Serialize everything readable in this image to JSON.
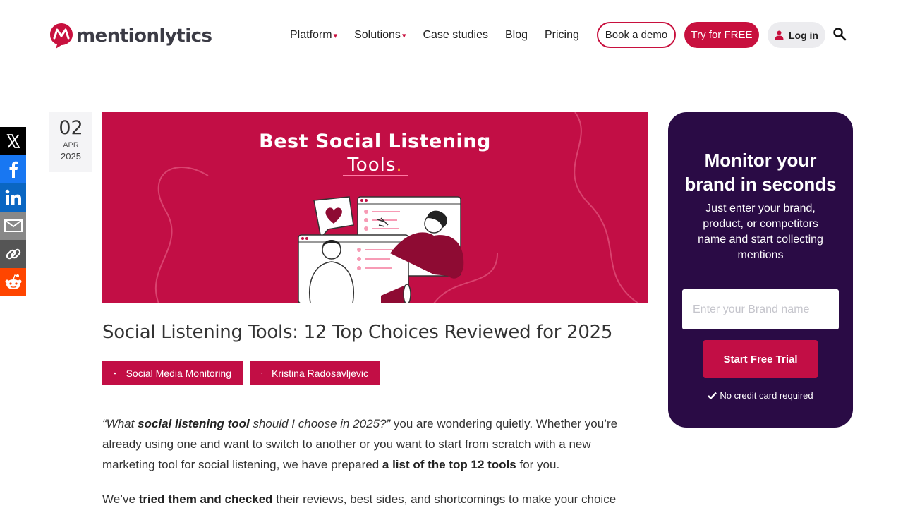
{
  "brand": {
    "name": "mentionlytics",
    "accent": "#c8103e",
    "dark": "#2a0b45"
  },
  "nav": {
    "items": [
      {
        "label": "Platform",
        "dropdown": true
      },
      {
        "label": "Solutions",
        "dropdown": true
      },
      {
        "label": "Case studies",
        "dropdown": false
      },
      {
        "label": "Blog",
        "dropdown": false
      },
      {
        "label": "Pricing",
        "dropdown": false
      }
    ],
    "caret": "▾",
    "book_demo": "Book a demo",
    "try_free": "Try for FREE",
    "login": "Log in",
    "search_icon": "search-icon"
  },
  "share": [
    {
      "name": "x",
      "bg": "#000000",
      "icon": "x-icon"
    },
    {
      "name": "facebook",
      "bg": "#1877f2",
      "icon": "facebook-icon"
    },
    {
      "name": "linkedin",
      "bg": "#0a66c2",
      "icon": "linkedin-icon"
    },
    {
      "name": "email",
      "bg": "#888888",
      "icon": "mail-icon"
    },
    {
      "name": "copy-link",
      "bg": "#555555",
      "icon": "link-icon"
    },
    {
      "name": "reddit",
      "bg": "#ff4500",
      "icon": "reddit-icon"
    }
  ],
  "post": {
    "date": {
      "day": "02",
      "month": "APR",
      "year": "2025"
    },
    "hero": {
      "title": "Best Social Listening",
      "subtitle": "Tools",
      "subtitle_dot": "."
    },
    "title": "Social Listening Tools: 12 Top Choices Reviewed for 2025",
    "category": "Social Media Monitoring",
    "author": "Kristina Radosavljevic",
    "p1": {
      "q1": "“What ",
      "q2": "social listening tool",
      "q3": " should I choose in 2025?”",
      "t1": " you are wondering quietly. Whether you’re already using one and want to switch to another or you want to start from scratch with a new marketing tool for social listening, we have prepared ",
      "b1": "a list of the top 12 tools",
      "t2": " for you."
    },
    "p2": {
      "t1": "We’ve ",
      "b1": "tried them and checked",
      "t2": " their reviews, best sides, and shortcomings to make your choice as"
    }
  },
  "widget": {
    "title": "Monitor your brand in seconds",
    "description": "Just enter your brand, product, or competitors name and start collecting mentions",
    "input_placeholder": "Enter your Brand name",
    "cta": "Start Free Trial",
    "note": "No credit card required"
  }
}
